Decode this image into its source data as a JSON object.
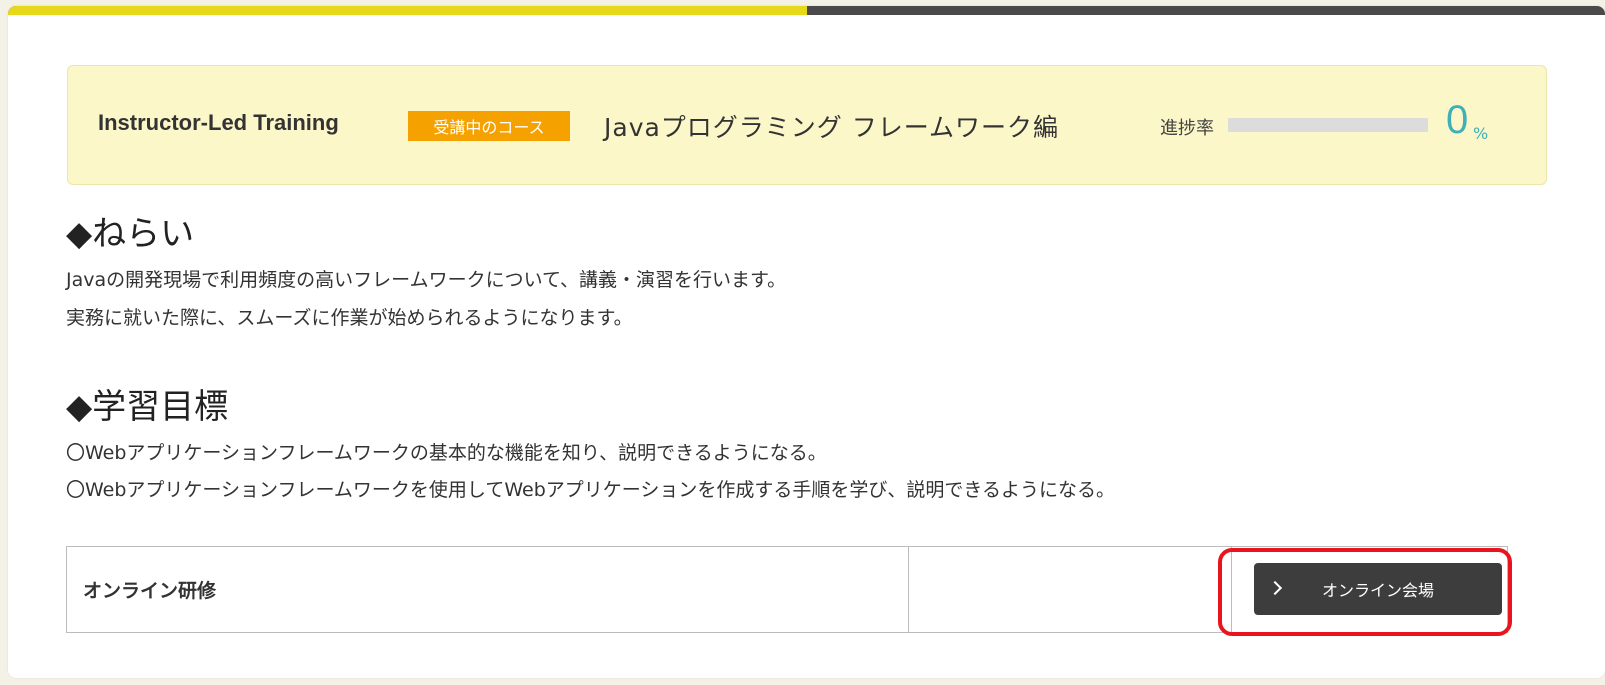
{
  "header": {
    "program_label": "Instructor-Led Training",
    "badge_label": "受講中のコース",
    "course_title": "Javaプログラミング フレームワーク編",
    "progress_label": "進捗率",
    "progress_value": "0",
    "progress_unit": "%",
    "progress_fraction": 0
  },
  "top_progress": {
    "fraction": 0.5,
    "fill_color": "#e8d81a",
    "track_color": "#4a4a4a"
  },
  "aims": {
    "heading": "◆ねらい",
    "lines": [
      "Javaの開発現場で利用頻度の高いフレームワークについて、講義・演習を行います。",
      "実務に就いた際に、スムーズに作業が始められるようになります。"
    ]
  },
  "goals": {
    "heading": "◆学習目標",
    "lines": [
      "〇Webアプリケーションフレームワークの基本的な機能を知り、説明できるようになる。",
      "〇Webアプリケーションフレームワークを使用してWebアプリケーションを作成する手順を学び、説明できるようになる。"
    ]
  },
  "session": {
    "name": "オンライン研修",
    "button_label": "オンライン会場",
    "button_icon": "chevron-right-icon"
  },
  "colors": {
    "accent": "#e8d81a",
    "badge": "#f5a100",
    "progress_teal": "#3fb0b8",
    "highlight": "#e8141e"
  }
}
